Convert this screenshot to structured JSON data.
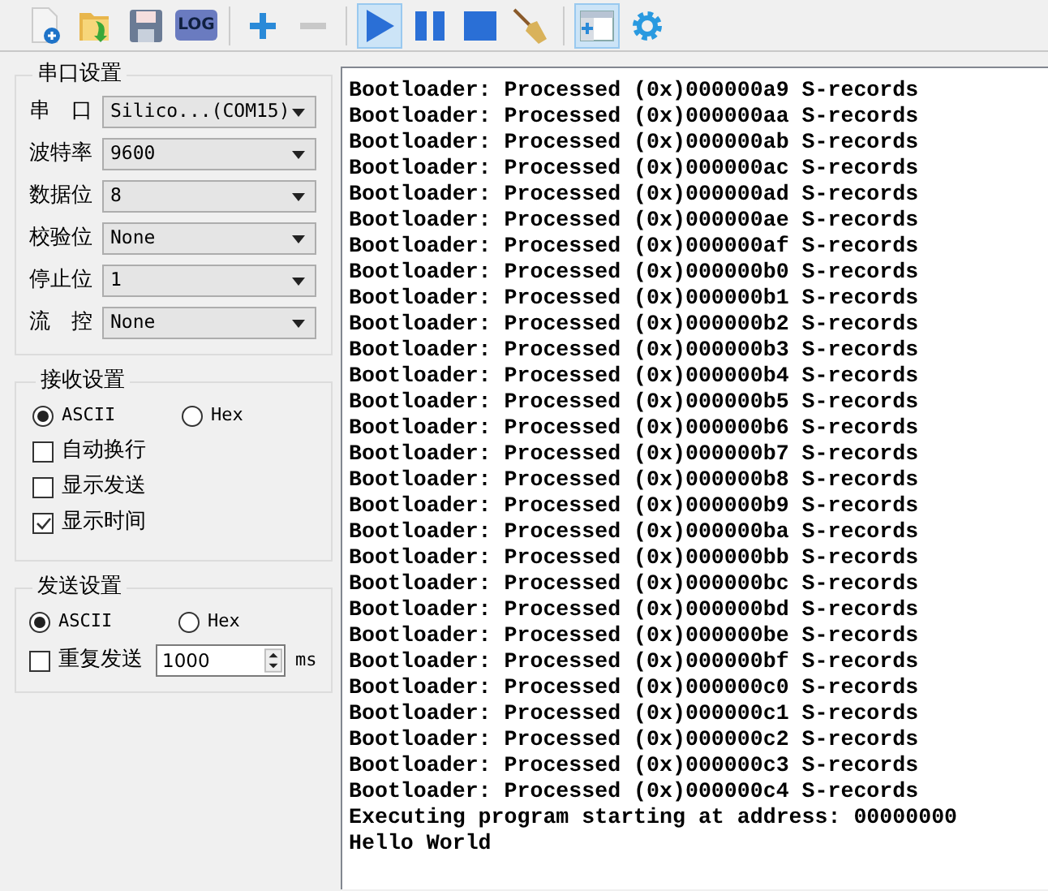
{
  "toolbar": [
    {
      "kind": "new-file",
      "selected": false,
      "disabled": false
    },
    {
      "kind": "open",
      "selected": false,
      "disabled": false
    },
    {
      "kind": "save",
      "selected": false,
      "disabled": false
    },
    {
      "kind": "log",
      "label": "LOG",
      "selected": false,
      "disabled": false
    },
    {
      "kind": "separator"
    },
    {
      "kind": "add",
      "selected": false,
      "disabled": false
    },
    {
      "kind": "remove",
      "selected": false,
      "disabled": true
    },
    {
      "kind": "separator"
    },
    {
      "kind": "play",
      "selected": true,
      "disabled": false
    },
    {
      "kind": "pause",
      "selected": false,
      "disabled": false
    },
    {
      "kind": "stop",
      "selected": false,
      "disabled": false
    },
    {
      "kind": "clear",
      "selected": false,
      "disabled": false
    },
    {
      "kind": "separator"
    },
    {
      "kind": "panel",
      "selected": true,
      "disabled": false
    },
    {
      "kind": "settings",
      "selected": false,
      "disabled": false
    }
  ],
  "serial_settings": {
    "title": "串口设置",
    "fields": [
      {
        "label": "串　口",
        "value": "Silico...(COM15)"
      },
      {
        "label": "波特率",
        "value": "9600"
      },
      {
        "label": "数据位",
        "value": "8"
      },
      {
        "label": "校验位",
        "value": "None"
      },
      {
        "label": "停止位",
        "value": "1"
      },
      {
        "label": "流　控",
        "value": "None"
      }
    ]
  },
  "receive_settings": {
    "title": "接收设置",
    "format": [
      {
        "label": "ASCII",
        "selected": true
      },
      {
        "label": "Hex",
        "selected": false
      }
    ],
    "options": [
      {
        "label": "自动换行",
        "checked": false
      },
      {
        "label": "显示发送",
        "checked": false
      },
      {
        "label": "显示时间",
        "checked": true
      }
    ]
  },
  "send_settings": {
    "title": "发送设置",
    "format": [
      {
        "label": "ASCII",
        "selected": true
      },
      {
        "label": "Hex",
        "selected": false
      }
    ],
    "repeat": {
      "label": "重复发送",
      "checked": false,
      "value": "1000",
      "unit": "ms"
    }
  },
  "terminal": {
    "lines": [
      "Bootloader: Processed (0x)000000a9 S-records",
      "Bootloader: Processed (0x)000000aa S-records",
      "Bootloader: Processed (0x)000000ab S-records",
      "Bootloader: Processed (0x)000000ac S-records",
      "Bootloader: Processed (0x)000000ad S-records",
      "Bootloader: Processed (0x)000000ae S-records",
      "Bootloader: Processed (0x)000000af S-records",
      "Bootloader: Processed (0x)000000b0 S-records",
      "Bootloader: Processed (0x)000000b1 S-records",
      "Bootloader: Processed (0x)000000b2 S-records",
      "Bootloader: Processed (0x)000000b3 S-records",
      "Bootloader: Processed (0x)000000b4 S-records",
      "Bootloader: Processed (0x)000000b5 S-records",
      "Bootloader: Processed (0x)000000b6 S-records",
      "Bootloader: Processed (0x)000000b7 S-records",
      "Bootloader: Processed (0x)000000b8 S-records",
      "Bootloader: Processed (0x)000000b9 S-records",
      "Bootloader: Processed (0x)000000ba S-records",
      "Bootloader: Processed (0x)000000bb S-records",
      "Bootloader: Processed (0x)000000bc S-records",
      "Bootloader: Processed (0x)000000bd S-records",
      "Bootloader: Processed (0x)000000be S-records",
      "Bootloader: Processed (0x)000000bf S-records",
      "Bootloader: Processed (0x)000000c0 S-records",
      "Bootloader: Processed (0x)000000c1 S-records",
      "Bootloader: Processed (0x)000000c2 S-records",
      "Bootloader: Processed (0x)000000c3 S-records",
      "Bootloader: Processed (0x)000000c4 S-records",
      "Executing program starting at address: 00000000",
      "Hello World"
    ]
  }
}
